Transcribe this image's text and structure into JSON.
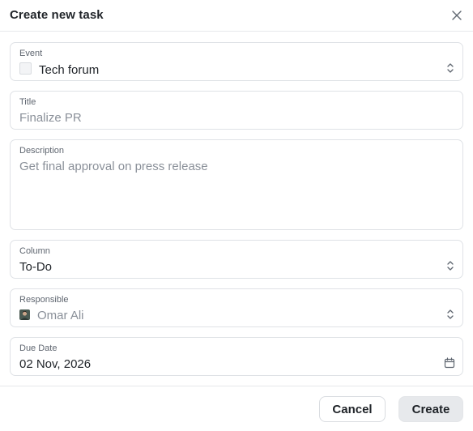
{
  "dialog": {
    "title": "Create new task"
  },
  "fields": {
    "event": {
      "label": "Event",
      "value": "Tech forum",
      "icon": "color-swatch-icon"
    },
    "title": {
      "label": "Title",
      "placeholder": "Finalize PR"
    },
    "description": {
      "label": "Description",
      "placeholder": "Get final approval on press release"
    },
    "column": {
      "label": "Column",
      "value": "To-Do"
    },
    "responsible": {
      "label": "Responsible",
      "value": "Omar Ali",
      "icon": "avatar"
    },
    "due_date": {
      "label": "Due Date",
      "value": "02 Nov, 2026",
      "icon": "calendar-icon"
    }
  },
  "footer": {
    "cancel_label": "Cancel",
    "create_label": "Create"
  },
  "colors": {
    "border": "#dfe2e6",
    "muted_text": "#8a9099",
    "primary_button_bg": "#e7e9ec"
  }
}
